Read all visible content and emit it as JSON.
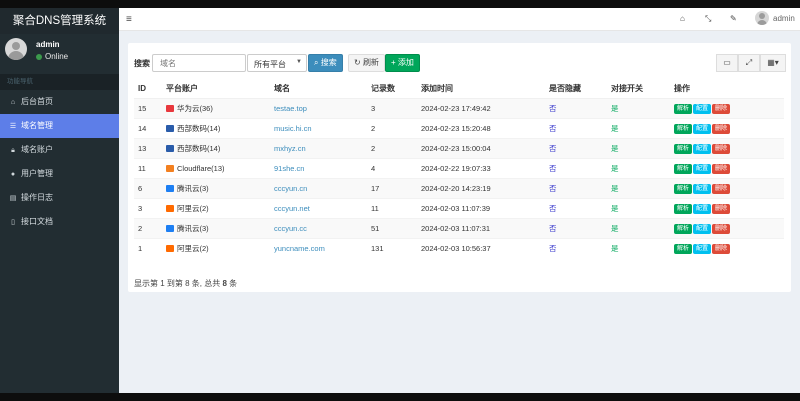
{
  "app": {
    "title": "聚合DNS管理系统"
  },
  "user": {
    "name": "admin",
    "status": "Online"
  },
  "sidebar": {
    "header": "功能导航",
    "items": [
      {
        "label": "后台首页",
        "icon": "home-icon"
      },
      {
        "label": "域名管理",
        "icon": "list-icon",
        "active": true
      },
      {
        "label": "域名账户",
        "icon": "lock-icon"
      },
      {
        "label": "用户管理",
        "icon": "user-icon"
      },
      {
        "label": "操作日志",
        "icon": "file-icon"
      },
      {
        "label": "接口文档",
        "icon": "doc-icon"
      }
    ]
  },
  "header": {
    "username": "admin"
  },
  "toolbar": {
    "search_label": "搜索",
    "search_placeholder": "域名",
    "platform_select": "所有平台",
    "search_button": "搜索",
    "refresh_button": "刷新",
    "add_button": "添加"
  },
  "table": {
    "columns": [
      "ID",
      "平台账户",
      "域名",
      "记录数",
      "添加时间",
      "是否隐藏",
      "对接开关",
      "操作"
    ],
    "actions": {
      "parse": "解析",
      "config": "配置",
      "delete": "删除"
    },
    "rows": [
      {
        "id": "15",
        "platform": "华为云(36)",
        "platform_color": "#e8383d",
        "domain": "testae.top",
        "records": "3",
        "added": "2024-02-23 17:49:42",
        "hidden": "否",
        "enabled": "是"
      },
      {
        "id": "14",
        "platform": "西部数码(14)",
        "platform_color": "#2a5caa",
        "domain": "music.hi.cn",
        "records": "2",
        "added": "2024-02-23 15:20:48",
        "hidden": "否",
        "enabled": "是"
      },
      {
        "id": "13",
        "platform": "西部数码(14)",
        "platform_color": "#2a5caa",
        "domain": "mxhyz.cn",
        "records": "2",
        "added": "2024-02-23 15:00:04",
        "hidden": "否",
        "enabled": "是"
      },
      {
        "id": "11",
        "platform": "Cloudflare(13)",
        "platform_color": "#f38020",
        "domain": "91she.cn",
        "records": "4",
        "added": "2024-02-22 19:07:33",
        "hidden": "否",
        "enabled": "是"
      },
      {
        "id": "6",
        "platform": "腾讯云(3)",
        "platform_color": "#1d7ff3",
        "domain": "cccyun.cn",
        "records": "17",
        "added": "2024-02-20 14:23:19",
        "hidden": "否",
        "enabled": "是"
      },
      {
        "id": "3",
        "platform": "阿里云(2)",
        "platform_color": "#ff6a00",
        "domain": "cccyun.net",
        "records": "11",
        "added": "2024-02-03 11:07:39",
        "hidden": "否",
        "enabled": "是"
      },
      {
        "id": "2",
        "platform": "腾讯云(3)",
        "platform_color": "#1d7ff3",
        "domain": "cccyun.cc",
        "records": "51",
        "added": "2024-02-03 11:07:31",
        "hidden": "否",
        "enabled": "是"
      },
      {
        "id": "1",
        "platform": "阿里云(2)",
        "platform_color": "#ff6a00",
        "domain": "yuncname.com",
        "records": "131",
        "added": "2024-02-03 10:56:37",
        "hidden": "否",
        "enabled": "是"
      }
    ]
  },
  "pagination": {
    "prefix": "显示第 1 到第 8 条, 总共 ",
    "total": "8",
    "suffix": " 条"
  }
}
